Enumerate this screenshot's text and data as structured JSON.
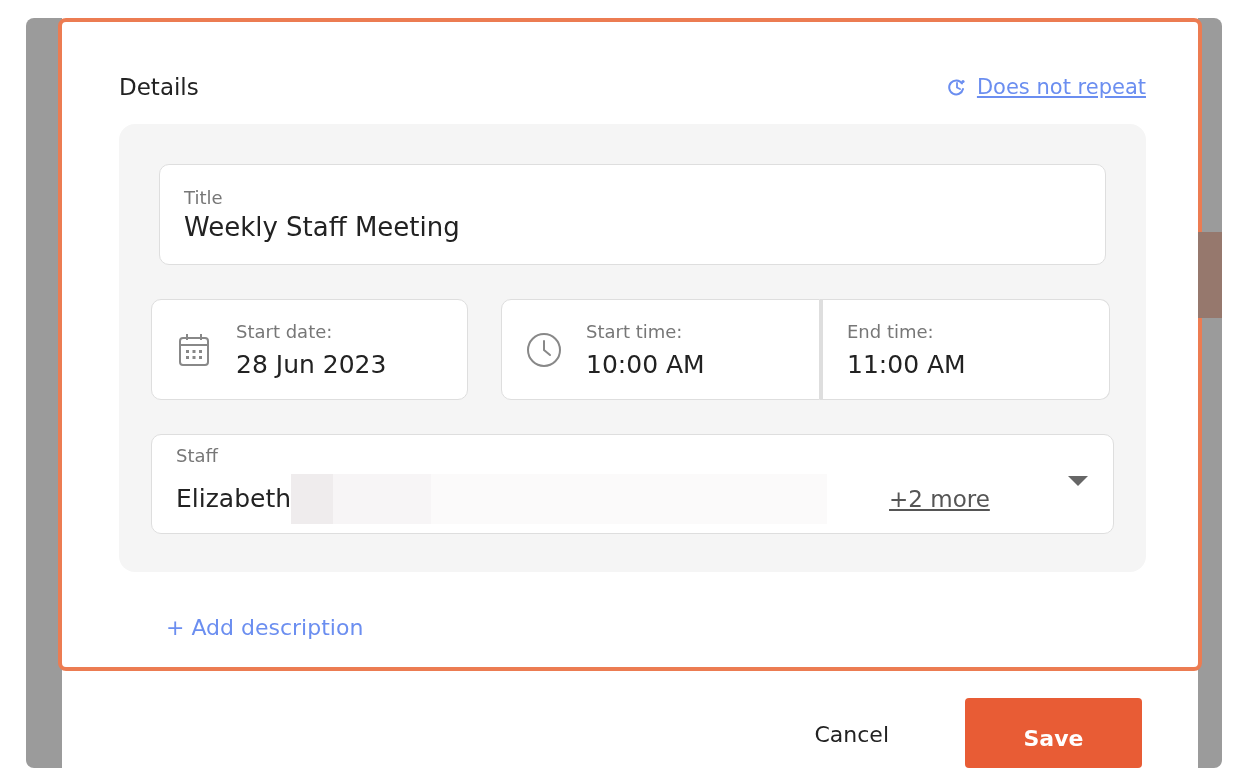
{
  "dialog": {
    "heading": "Details",
    "repeat_link": "Does not repeat",
    "title_field": {
      "label": "Title",
      "value": "Weekly Staff Meeting"
    },
    "start_date": {
      "label": "Start date:",
      "value": "28 Jun 2023"
    },
    "start_time": {
      "label": "Start time:",
      "value": "10:00 AM"
    },
    "end_time": {
      "label": "End time:",
      "value": "11:00 AM"
    },
    "staff": {
      "label": "Staff",
      "value": "Elizabeth",
      "more": "+2 more"
    },
    "add_description": "+ Add description",
    "buttons": [
      {
        "label": "Cancel",
        "kind": "secondary"
      },
      {
        "label": "Save",
        "kind": "primary"
      }
    ]
  }
}
